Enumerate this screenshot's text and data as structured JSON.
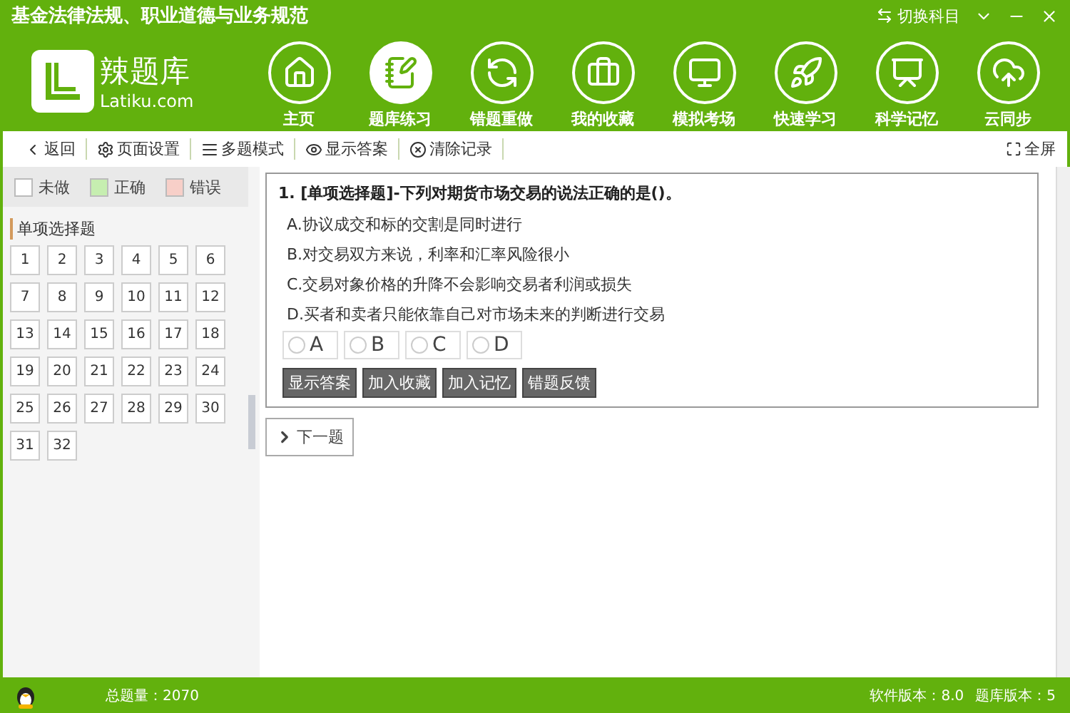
{
  "window": {
    "title": "基金法律法规、职业道德与业务规范",
    "switch_subject": "切换科目"
  },
  "logo": {
    "name": "辣题库",
    "domain": "Latiku.com"
  },
  "nav": [
    {
      "label": "主页",
      "selected": false
    },
    {
      "label": "题库练习",
      "selected": true
    },
    {
      "label": "错题重做",
      "selected": false
    },
    {
      "label": "我的收藏",
      "selected": false
    },
    {
      "label": "模拟考场",
      "selected": false
    },
    {
      "label": "快速学习",
      "selected": false
    },
    {
      "label": "科学记忆",
      "selected": false
    },
    {
      "label": "云同步",
      "selected": false
    }
  ],
  "toolbar": [
    "返回",
    "页面设置",
    "多题模式",
    "显示答案",
    "清除记录"
  ],
  "fullscreen": "全屏",
  "legend": [
    {
      "label": "未做",
      "color": "#ffffff"
    },
    {
      "label": "正确",
      "color": "#c6eeb0"
    },
    {
      "label": "错误",
      "color": "#f7cfc8"
    }
  ],
  "section": "单项选择题",
  "numbers": [
    "1",
    "2",
    "3",
    "4",
    "5",
    "6",
    "7",
    "8",
    "9",
    "10",
    "11",
    "12",
    "13",
    "14",
    "15",
    "16",
    "17",
    "18",
    "19",
    "20",
    "21",
    "22",
    "23",
    "24",
    "25",
    "26",
    "27",
    "28",
    "29",
    "30",
    "31",
    "32"
  ],
  "question": {
    "title": "1. [单项选择题]-下列对期货市场交易的说法正确的是()。",
    "options": [
      "A.协议成交和标的交割是同时进行",
      "B.对交易双方来说，利率和汇率风险很小",
      "C.交易对象价格的升降不会影响交易者利润或损失",
      "D.买者和卖者只能依靠自己对市场未来的判断进行交易"
    ],
    "answers": [
      {
        "label": "A",
        "selected": false
      },
      {
        "label": "B",
        "selected": false
      },
      {
        "label": "C",
        "selected": false
      },
      {
        "label": "D",
        "selected": false
      }
    ],
    "actions": [
      "显示答案",
      "加入收藏",
      "加入记忆",
      "错题反馈"
    ]
  },
  "next": "下一题",
  "status": {
    "total": "总题量：2070",
    "software_version": "软件版本：8.0",
    "bank_version": "题库版本：5"
  }
}
